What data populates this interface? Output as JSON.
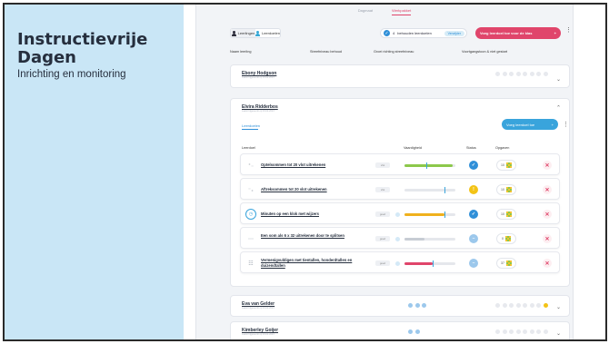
{
  "slide": {
    "title_line1": "Instructievrije",
    "title_line2": "Dagen",
    "subtitle": "Inrichting en monitoring"
  },
  "topnav": {
    "tabs": [
      "Dagmaat",
      "Werkpakket"
    ],
    "active_index": 1
  },
  "toolbar": {
    "toggle": [
      "Leerlingen",
      "Leerdoelen"
    ],
    "behouden_count": "4",
    "behouden_label": "behouden leerdoelen",
    "behouden_action": "Verwijder",
    "add_all_label": "Voeg leerdoel toe voor de klas",
    "plus": "+"
  },
  "columns": {
    "name": "Naam leerling",
    "behouden": "Streefniveau behoud",
    "richting": "Groei richting streefniveau",
    "voortgang": "Voortgangstoon & niet gestart"
  },
  "students": [
    {
      "name": "Ebony Hodgson",
      "updated": "Laatst bijgewerkt op 03-02-2023"
    },
    {
      "name": "Elvira Ridderbos",
      "updated": "Laatst bijgewerkt op 03-02-2023"
    },
    {
      "name": "Eva van Gelder",
      "updated": "Laatst bijgewerkt op 03-02-2023"
    },
    {
      "name": "Kimberley Goijer",
      "updated": "Laatst bijgewerkt op 03-02-2023"
    }
  ],
  "expanded": {
    "tab": "Leerdoelen",
    "add_label": "Voeg leerdoel toe",
    "headers": {
      "leerdoel": "Leerdoel",
      "vaardigheid": "Vaardigheid",
      "status": "Status",
      "opgaven": "Opgaven"
    },
    "rows": [
      {
        "title": "Optelsommen tot 20 vlot uitrekenen",
        "tag": "vlot",
        "status": "done",
        "opgaven": "10",
        "fill_pct": 95,
        "fill_color": "#8cc84b",
        "mark_pct": 42
      },
      {
        "title": "Aftreksommen tot 20 vlot uitrekenen",
        "tag": "vlot",
        "status": "warn",
        "opgaven": "10",
        "fill_pct": 0,
        "fill_color": "#f0b11d",
        "mark_pct": 78
      },
      {
        "title": "Minuten op een klok met wijzers",
        "tag": "goed",
        "status": "done",
        "opgaven": "10",
        "fill_pct": 78,
        "fill_color": "#f0b11d",
        "mark_pct": 78
      },
      {
        "title": "Een som als 6 x 32 uitrekenen door te splitsen",
        "tag": "goed",
        "status": "pending",
        "opgaven": "0",
        "fill_pct": 40,
        "fill_color": "#c7ccd4",
        "mark_pct": 0
      },
      {
        "title": "Vermenigvuldigen met tientallen, honderdtallen en duizendtallen",
        "tag": "goed",
        "status": "pending",
        "opgaven": "37",
        "fill_pct": 55,
        "fill_color": "#e0456b",
        "mark_pct": 55
      }
    ]
  },
  "status_icons": {
    "done": "✓",
    "warn": "!",
    "pending": "–"
  },
  "delete_icon": "✕",
  "chevron": "⌄"
}
